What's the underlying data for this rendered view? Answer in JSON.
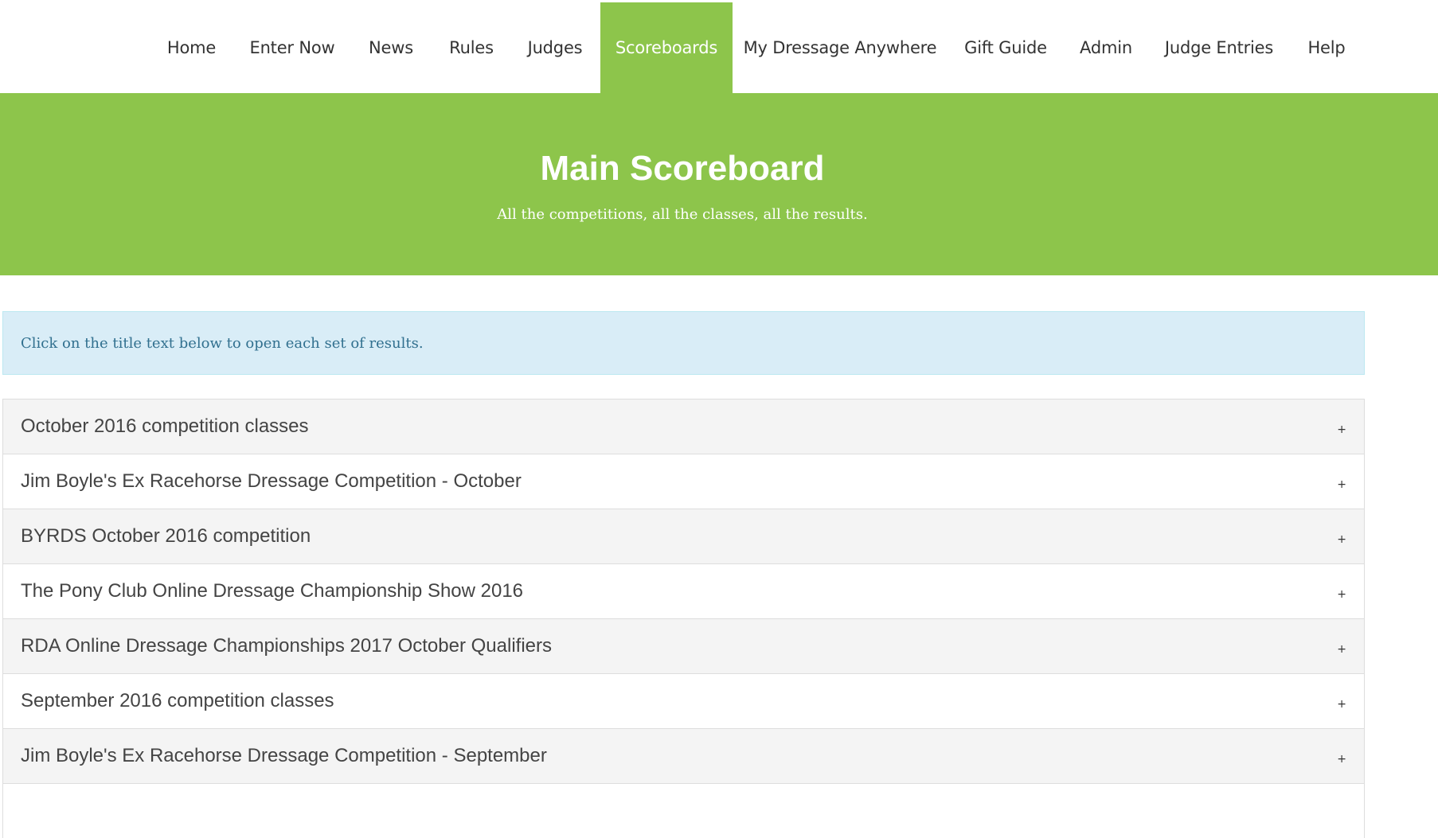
{
  "nav": {
    "items": [
      {
        "label": "Home",
        "active": false
      },
      {
        "label": "Enter Now",
        "active": false
      },
      {
        "label": "News",
        "active": false
      },
      {
        "label": "Rules",
        "active": false
      },
      {
        "label": "Judges",
        "active": false
      },
      {
        "label": "Scoreboards",
        "active": true
      },
      {
        "label": "My Dressage Anywhere",
        "active": false
      },
      {
        "label": "Gift Guide",
        "active": false
      },
      {
        "label": "Admin",
        "active": false
      },
      {
        "label": "Judge Entries",
        "active": false
      },
      {
        "label": "Help",
        "active": false
      }
    ]
  },
  "hero": {
    "title": "Main Scoreboard",
    "subtitle": "All the competitions, all the classes, all the results."
  },
  "info": {
    "text": "Click on the title text below to open each set of results."
  },
  "accordion": {
    "toggle_symbol": "+",
    "items": [
      {
        "title": "October 2016 competition classes"
      },
      {
        "title": "Jim Boyle's Ex Racehorse Dressage Competition - October"
      },
      {
        "title": "BYRDS October 2016 competition"
      },
      {
        "title": "The Pony Club Online Dressage Championship Show 2016"
      },
      {
        "title": "RDA Online Dressage Championships 2017 October Qualifiers"
      },
      {
        "title": "September 2016 competition classes"
      },
      {
        "title": "Jim Boyle's Ex Racehorse Dressage Competition - September"
      },
      {
        "title": ""
      }
    ]
  },
  "colors": {
    "brand_green": "#8dc54b",
    "info_bg": "#d9edf7",
    "info_text": "#31708f"
  }
}
